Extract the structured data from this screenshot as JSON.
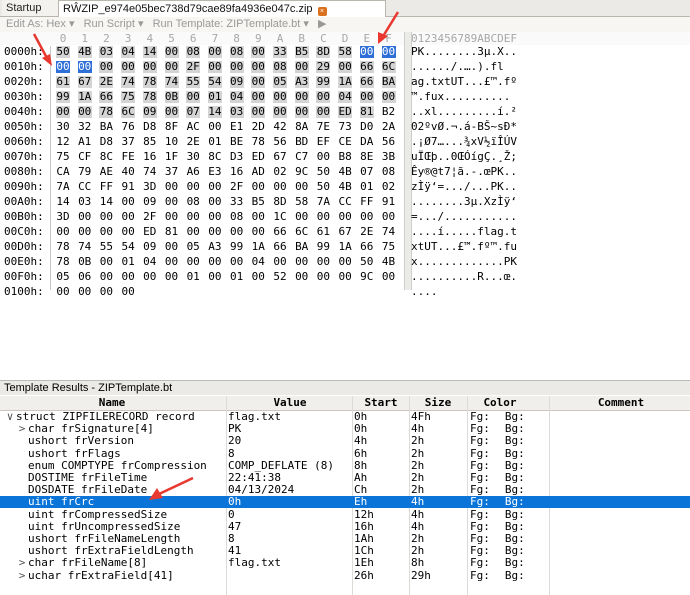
{
  "tabs": {
    "startup": "Startup",
    "file": "RŴZIP_e974e05bec738d79cae89fa4936e047c.zip"
  },
  "toolbar": {
    "edit_as": "Edit As: Hex ▾",
    "run_script": "Run Script ▾",
    "run_template": "Run Template: ZIPTemplate.bt ▾",
    "play": "▶"
  },
  "hex": {
    "col_labels": [
      "0",
      "1",
      "2",
      "3",
      "4",
      "5",
      "6",
      "7",
      "8",
      "9",
      "A",
      "B",
      "C",
      "D",
      "E",
      "F"
    ],
    "ascii_header": "0123456789ABCDEF",
    "rows": [
      {
        "addr": "0000h:",
        "bytes": [
          "50",
          "4B",
          "03",
          "04",
          "14",
          "00",
          "08",
          "00",
          "08",
          "00",
          "33",
          "B5",
          "8D",
          "58",
          "00",
          "00"
        ],
        "ascii": "PK........3µ.X.."
      },
      {
        "addr": "0010h:",
        "bytes": [
          "00",
          "00",
          "00",
          "00",
          "00",
          "00",
          "2F",
          "00",
          "00",
          "00",
          "08",
          "00",
          "29",
          "00",
          "66",
          "6C"
        ],
        "ascii": "....../.….).fl"
      },
      {
        "addr": "0020h:",
        "bytes": [
          "61",
          "67",
          "2E",
          "74",
          "78",
          "74",
          "55",
          "54",
          "09",
          "00",
          "05",
          "A3",
          "99",
          "1A",
          "66",
          "BA"
        ],
        "ascii": "ag.txtUT...£™.fº"
      },
      {
        "addr": "0030h:",
        "bytes": [
          "99",
          "1A",
          "66",
          "75",
          "78",
          "0B",
          "00",
          "01",
          "04",
          "00",
          "00",
          "00",
          "00",
          "04",
          "00",
          "00"
        ],
        "ascii": "™.fux.........."
      },
      {
        "addr": "0040h:",
        "bytes": [
          "00",
          "00",
          "78",
          "6C",
          "09",
          "00",
          "07",
          "14",
          "03",
          "00",
          "00",
          "00",
          "00",
          "ED",
          "81",
          "B2"
        ],
        "ascii": "..xl.........í.²"
      },
      {
        "addr": "0050h:",
        "bytes": [
          "30",
          "32",
          "BA",
          "76",
          "D8",
          "8F",
          "AC",
          "00",
          "E1",
          "2D",
          "42",
          "8A",
          "7E",
          "73",
          "D0",
          "2A"
        ],
        "ascii": "02ºvØ.¬.á-BŠ~sÐ*"
      },
      {
        "addr": "0060h:",
        "bytes": [
          "12",
          "A1",
          "D8",
          "37",
          "85",
          "10",
          "2E",
          "01",
          "BE",
          "78",
          "56",
          "BD",
          "EF",
          "CE",
          "DA",
          "56"
        ],
        "ascii": ".¡Ø7…...¾xV½ïÎÚV"
      },
      {
        "addr": "0070h:",
        "bytes": [
          "75",
          "CF",
          "8C",
          "FE",
          "16",
          "1F",
          "30",
          "8C",
          "D3",
          "ED",
          "67",
          "C7",
          "00",
          "B8",
          "8E",
          "3B"
        ],
        "ascii": "uÏŒþ..0ŒÓígÇ.¸Ž;"
      },
      {
        "addr": "0080h:",
        "bytes": [
          "CA",
          "79",
          "AE",
          "40",
          "74",
          "37",
          "A6",
          "E3",
          "16",
          "AD",
          "02",
          "9C",
          "50",
          "4B",
          "07",
          "08"
        ],
        "ascii": "Êy®@t7¦ã.-.œPK.."
      },
      {
        "addr": "0090h:",
        "bytes": [
          "7A",
          "CC",
          "FF",
          "91",
          "3D",
          "00",
          "00",
          "00",
          "2F",
          "00",
          "00",
          "00",
          "50",
          "4B",
          "01",
          "02"
        ],
        "ascii": "zÌÿ‘=.../...PK.."
      },
      {
        "addr": "00A0h:",
        "bytes": [
          "14",
          "03",
          "14",
          "00",
          "09",
          "00",
          "08",
          "00",
          "33",
          "B5",
          "8D",
          "58",
          "7A",
          "CC",
          "FF",
          "91"
        ],
        "ascii": "........3µ.XzÌÿ‘"
      },
      {
        "addr": "00B0h:",
        "bytes": [
          "3D",
          "00",
          "00",
          "00",
          "2F",
          "00",
          "00",
          "00",
          "08",
          "00",
          "1C",
          "00",
          "00",
          "00",
          "00",
          "00"
        ],
        "ascii": "=.../..........."
      },
      {
        "addr": "00C0h:",
        "bytes": [
          "00",
          "00",
          "00",
          "00",
          "ED",
          "81",
          "00",
          "00",
          "00",
          "00",
          "66",
          "6C",
          "61",
          "67",
          "2E",
          "74"
        ],
        "ascii": "....í.....flag.t"
      },
      {
        "addr": "00D0h:",
        "bytes": [
          "78",
          "74",
          "55",
          "54",
          "09",
          "00",
          "05",
          "A3",
          "99",
          "1A",
          "66",
          "BA",
          "99",
          "1A",
          "66",
          "75"
        ],
        "ascii": "xtUT...£™.fº™.fu"
      },
      {
        "addr": "00E0h:",
        "bytes": [
          "78",
          "0B",
          "00",
          "01",
          "04",
          "00",
          "00",
          "00",
          "00",
          "04",
          "00",
          "00",
          "00",
          "00",
          "50",
          "4B"
        ],
        "ascii": "x.............PK"
      },
      {
        "addr": "00F0h:",
        "bytes": [
          "05",
          "06",
          "00",
          "00",
          "00",
          "00",
          "01",
          "00",
          "01",
          "00",
          "52",
          "00",
          "00",
          "00",
          "9C",
          "00"
        ],
        "ascii": "..........R...œ."
      },
      {
        "addr": "0100h:",
        "bytes": [
          "00",
          "00",
          "00",
          "00"
        ],
        "ascii": "...."
      }
    ]
  },
  "template": {
    "title": "Template Results - ZIPTemplate.bt",
    "columns": {
      "name": "Name",
      "value": "Value",
      "start": "Start",
      "size": "Size",
      "color": "Color",
      "comment": "Comment"
    },
    "rows": [
      {
        "expander": "∨",
        "indent": 0,
        "name": "struct ZIPFILERECORD record",
        "value": "flag.txt",
        "start": "0h",
        "size": "4Fh",
        "fg": "Fg:",
        "bg": "Bg:"
      },
      {
        "expander": ">",
        "indent": 1,
        "name": "char frSignature[4]",
        "value": "PK",
        "start": "0h",
        "size": "4h",
        "fg": "Fg:",
        "bg": "Bg:"
      },
      {
        "expander": "",
        "indent": 1,
        "name": "ushort frVersion",
        "value": "20",
        "start": "4h",
        "size": "2h",
        "fg": "Fg:",
        "bg": "Bg:"
      },
      {
        "expander": "",
        "indent": 1,
        "name": "ushort frFlags",
        "value": "8",
        "start": "6h",
        "size": "2h",
        "fg": "Fg:",
        "bg": "Bg:"
      },
      {
        "expander": "",
        "indent": 1,
        "name": "enum COMPTYPE frCompression",
        "value": "COMP_DEFLATE (8)",
        "start": "8h",
        "size": "2h",
        "fg": "Fg:",
        "bg": "Bg:"
      },
      {
        "expander": "",
        "indent": 1,
        "name": "DOSTIME frFileTime",
        "value": "22:41:38",
        "start": "Ah",
        "size": "2h",
        "fg": "Fg:",
        "bg": "Bg:"
      },
      {
        "expander": "",
        "indent": 1,
        "name": "DOSDATE frFileDate",
        "value": "04/13/2024",
        "start": "Ch",
        "size": "2h",
        "fg": "Fg:",
        "bg": "Bg:"
      },
      {
        "expander": "",
        "indent": 1,
        "name": "uint frCrc",
        "value": "0h",
        "start": "Eh",
        "size": "4h",
        "fg": "Fg:",
        "bg": "Bg:",
        "selected": true
      },
      {
        "expander": "",
        "indent": 1,
        "name": "uint frCompressedSize",
        "value": "0",
        "start": "12h",
        "size": "4h",
        "fg": "Fg:",
        "bg": "Bg:"
      },
      {
        "expander": "",
        "indent": 1,
        "name": "uint frUncompressedSize",
        "value": "47",
        "start": "16h",
        "size": "4h",
        "fg": "Fg:",
        "bg": "Bg:"
      },
      {
        "expander": "",
        "indent": 1,
        "name": "ushort frFileNameLength",
        "value": "8",
        "start": "1Ah",
        "size": "2h",
        "fg": "Fg:",
        "bg": "Bg:"
      },
      {
        "expander": "",
        "indent": 1,
        "name": "ushort frExtraFieldLength",
        "value": "41",
        "start": "1Ch",
        "size": "2h",
        "fg": "Fg:",
        "bg": "Bg:"
      },
      {
        "expander": ">",
        "indent": 1,
        "name": "char frFileName[8]",
        "value": "flag.txt",
        "start": "1Eh",
        "size": "8h",
        "fg": "Fg:",
        "bg": "Bg:"
      },
      {
        "expander": ">",
        "indent": 1,
        "name": "uchar frExtraField[41]",
        "value": "",
        "start": "26h",
        "size": "29h",
        "fg": "Fg:",
        "bg": "Bg:"
      }
    ]
  },
  "colors": {
    "selection": "#2f70d8",
    "template_selection": "#0a74d8",
    "highlight": "#d4d4d4",
    "arrow": "#e8382f"
  }
}
